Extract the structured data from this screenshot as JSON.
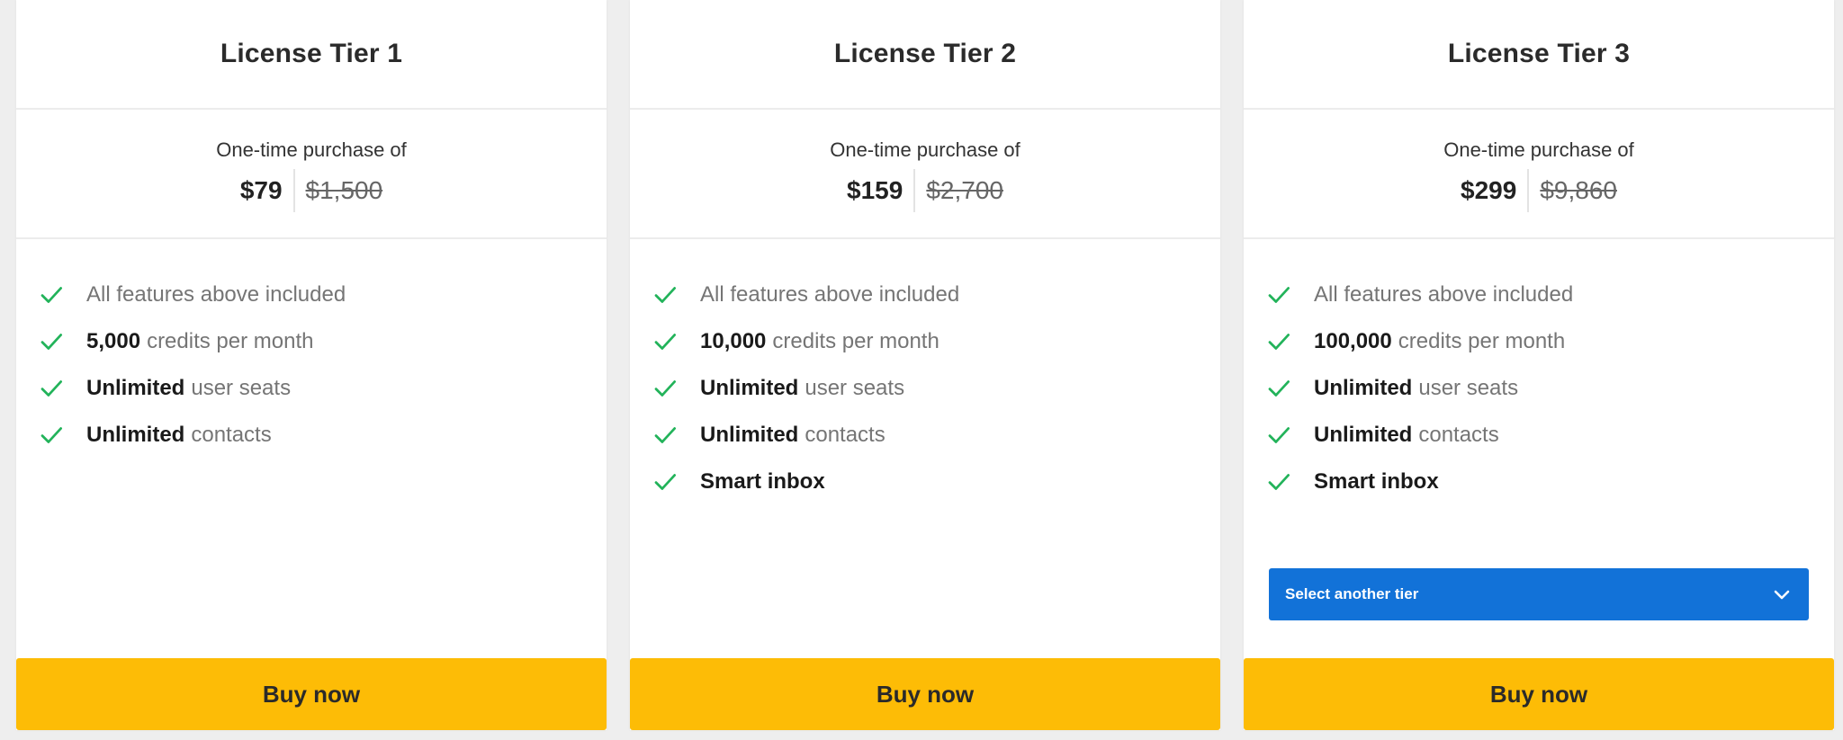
{
  "colors": {
    "buy_button_bg": "#fdbc06",
    "select_bg": "#1272d8",
    "check": "#22b35a"
  },
  "icons": {
    "check": "check-icon",
    "dropdown": "chevron-down-icon"
  },
  "tiers": [
    {
      "title": "License Tier 1",
      "price_caption": "One-time purchase of",
      "price_now": "$79",
      "price_old": "$1,500",
      "features": [
        {
          "bold": "",
          "text": "All features above included"
        },
        {
          "bold": "5,000",
          "text": "credits per month"
        },
        {
          "bold": "Unlimited",
          "text": "user seats"
        },
        {
          "bold": "Unlimited",
          "text": "contacts"
        }
      ],
      "buy_label": "Buy now"
    },
    {
      "title": "License Tier 2",
      "price_caption": "One-time purchase of",
      "price_now": "$159",
      "price_old": "$2,700",
      "features": [
        {
          "bold": "",
          "text": "All features above included"
        },
        {
          "bold": "10,000",
          "text": "credits per month"
        },
        {
          "bold": "Unlimited",
          "text": "user seats"
        },
        {
          "bold": "Unlimited",
          "text": "contacts"
        },
        {
          "bold": "Smart inbox",
          "text": ""
        }
      ],
      "buy_label": "Buy now"
    },
    {
      "title": "License Tier 3",
      "price_caption": "One-time purchase of",
      "price_now": "$299",
      "price_old": "$9,860",
      "features": [
        {
          "bold": "",
          "text": "All features above included"
        },
        {
          "bold": "100,000",
          "text": "credits per month"
        },
        {
          "bold": "Unlimited",
          "text": "user seats"
        },
        {
          "bold": "Unlimited",
          "text": "contacts"
        },
        {
          "bold": "Smart inbox",
          "text": ""
        }
      ],
      "select_label": "Select another tier",
      "buy_label": "Buy now"
    }
  ]
}
